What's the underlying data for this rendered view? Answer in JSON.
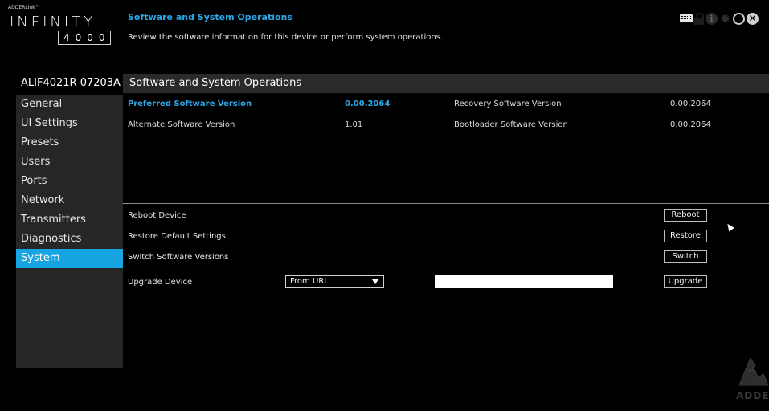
{
  "brand": {
    "small_label": "ADDERLink™",
    "name": "INFINITY",
    "number": "4000",
    "watermark": "ADDE"
  },
  "header": {
    "title": "Software and System Operations",
    "description": "Review the software information for this device or perform system operations."
  },
  "device_name": "ALIF4021R 07203A",
  "sidebar": {
    "items": [
      {
        "label": "General",
        "active": false
      },
      {
        "label": "UI Settings",
        "active": false
      },
      {
        "label": "Presets",
        "active": false
      },
      {
        "label": "Users",
        "active": false
      },
      {
        "label": "Ports",
        "active": false
      },
      {
        "label": "Network",
        "active": false
      },
      {
        "label": "Transmitters",
        "active": false
      },
      {
        "label": "Diagnostics",
        "active": false
      },
      {
        "label": "System",
        "active": true
      }
    ]
  },
  "section": {
    "title": "Software and System Operations"
  },
  "versions": {
    "preferred_label": "Preferred Software Version",
    "preferred_value": "0.00.2064",
    "recovery_label": "Recovery Software Version",
    "recovery_value": "0.00.2064",
    "alternate_label": "Alternate Software Version",
    "alternate_value": "1.01",
    "bootloader_label": "Bootloader Software Version",
    "bootloader_value": "0.00.2064"
  },
  "operations": {
    "reboot_label": "Reboot Device",
    "reboot_button": "Reboot",
    "restore_label": "Restore Default Settings",
    "restore_button": "Restore",
    "switch_label": "Switch Software Versions",
    "switch_button": "Switch",
    "upgrade_label": "Upgrade Device",
    "upgrade_source": "From URL",
    "upgrade_url": "",
    "upgrade_button": "Upgrade"
  },
  "icons": {
    "top_right": [
      "keyboard-icon",
      "lock-icon",
      "info-icon",
      "gear-icon",
      "power-icon",
      "close-icon"
    ]
  },
  "colors": {
    "accent": "#17a4e3",
    "highlight_text": "#2aa9ea",
    "background": "#000000",
    "sidebar_bg": "#262626"
  }
}
